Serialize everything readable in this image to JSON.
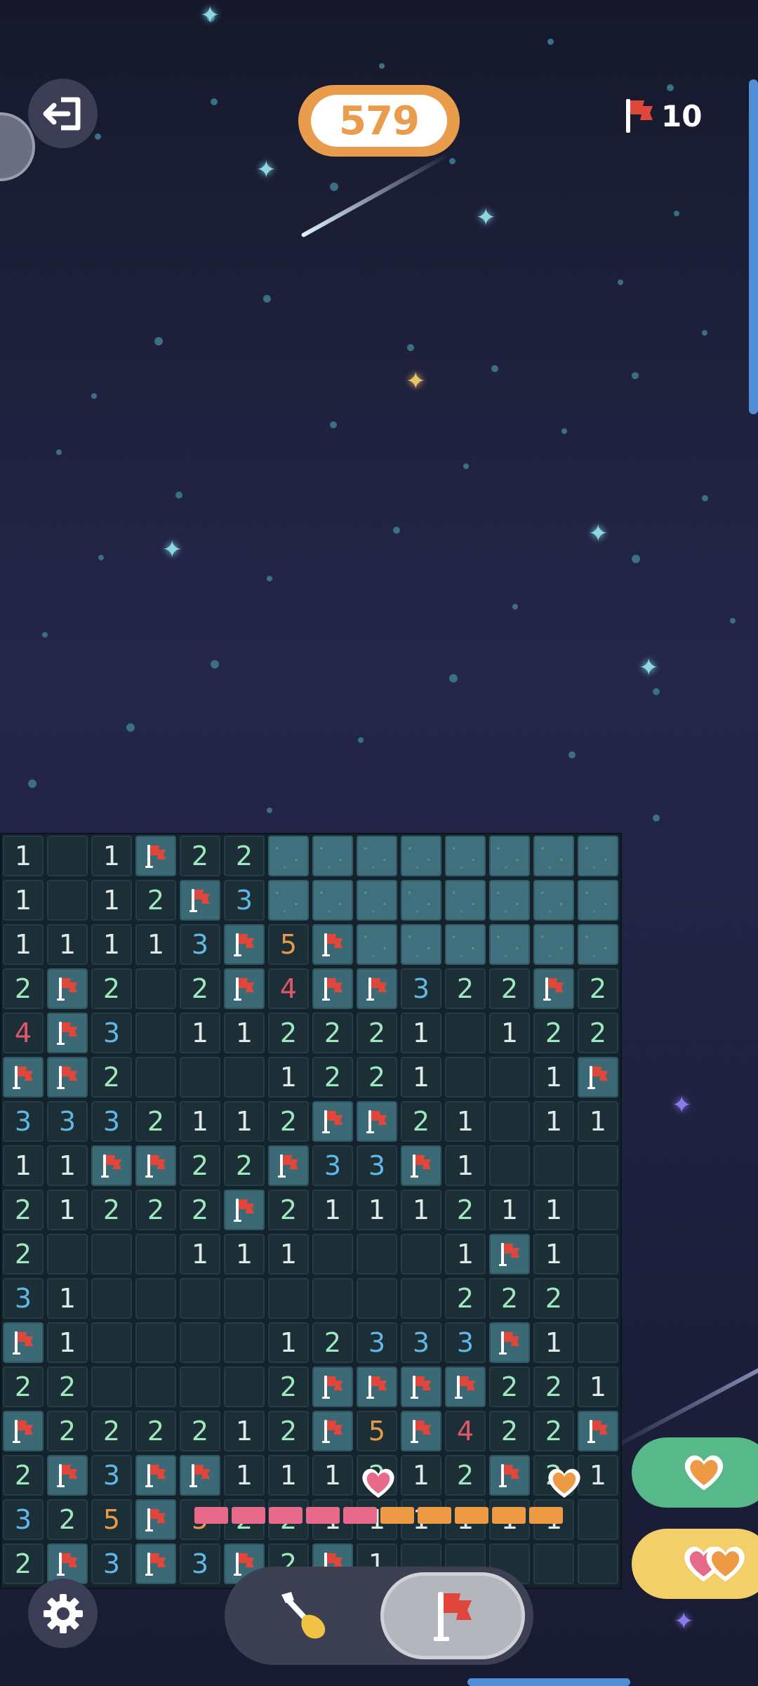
{
  "header": {
    "score": "579",
    "flags_remaining": "10"
  },
  "icons": {
    "exit": "exit-icon",
    "flag": "flag-icon",
    "settings": "gear-icon",
    "dig": "shovel-icon",
    "heart": "heart-icon",
    "double_heart": "double-heart-icon"
  },
  "colors": {
    "score_accent": "#e89c4c",
    "n1": "#dfe9e6",
    "n2": "#9fe8bd",
    "n3": "#5fb8e8",
    "n4": "#e2566a",
    "n5": "#e69a4a",
    "flag_red": "#e0473a",
    "life_green": "#57b98a",
    "life_yellow": "#f3cf6a",
    "progress_pink": "#e86a8a",
    "progress_orange": "#ee9a45"
  },
  "board": {
    "columns": 14,
    "rows": 17,
    "legend": "H = unrevealed, F = flag, . = empty revealed, 1-5 = adjacent count",
    "grid": [
      [
        "1",
        ".",
        "1",
        "F",
        "2",
        "2",
        "H",
        "H",
        "H",
        "H",
        "H",
        "H",
        "H",
        "H"
      ],
      [
        "1",
        ".",
        "1",
        "2",
        "F",
        "3",
        "H",
        "H",
        "H",
        "H",
        "H",
        "H",
        "H",
        "H"
      ],
      [
        "1",
        "1",
        "1",
        "1",
        "3",
        "F",
        "5",
        "F",
        "H",
        "H",
        "H",
        "H",
        "H",
        "H"
      ],
      [
        "2",
        "F",
        "2",
        ".",
        "2",
        "F",
        "4",
        "F",
        "F",
        "3",
        "2",
        "2",
        "F",
        "2"
      ],
      [
        "4",
        "F",
        "3",
        ".",
        "1",
        "1",
        "2",
        "2",
        "2",
        "1",
        ".",
        "1",
        "2",
        "2"
      ],
      [
        "F",
        "F",
        "2",
        ".",
        ".",
        ".",
        "1",
        "2",
        "2",
        "1",
        ".",
        ".",
        "1",
        "F"
      ],
      [
        "3",
        "3",
        "3",
        "2",
        "1",
        "1",
        "2",
        "F",
        "F",
        "2",
        "1",
        ".",
        "1",
        "1"
      ],
      [
        "1",
        "1",
        "F",
        "F",
        "2",
        "2",
        "F",
        "3",
        "3",
        "F",
        "1",
        ".",
        ".",
        "."
      ],
      [
        "2",
        "1",
        "2",
        "2",
        "2",
        "F",
        "2",
        "1",
        "1",
        "1",
        "2",
        "1",
        "1",
        "."
      ],
      [
        "2",
        ".",
        ".",
        ".",
        "1",
        "1",
        "1",
        ".",
        ".",
        ".",
        "1",
        "F",
        "1",
        "."
      ],
      [
        "3",
        "1",
        ".",
        ".",
        ".",
        ".",
        ".",
        ".",
        ".",
        ".",
        "2",
        "2",
        "2",
        "."
      ],
      [
        "F",
        "1",
        ".",
        ".",
        ".",
        ".",
        "1",
        "2",
        "3",
        "3",
        "3",
        "F",
        "1",
        "."
      ],
      [
        "2",
        "2",
        ".",
        ".",
        ".",
        ".",
        "2",
        "F",
        "F",
        "F",
        "F",
        "2",
        "2",
        "1"
      ],
      [
        "F",
        "2",
        "2",
        "2",
        "2",
        "1",
        "2",
        "F",
        "5",
        "F",
        "4",
        "2",
        "2",
        "F"
      ],
      [
        "2",
        "F",
        "3",
        "F",
        "F",
        "1",
        "1",
        "1",
        "2",
        "1",
        "2",
        "F",
        "2",
        "1"
      ],
      [
        "3",
        "2",
        "5",
        "F",
        "5",
        "2",
        "2",
        "1",
        "1",
        "1",
        "1",
        "1",
        "1",
        "."
      ],
      [
        "2",
        "F",
        "3",
        "F",
        "3",
        "F",
        "2",
        "F",
        "1",
        ".",
        ".",
        ".",
        ".",
        "."
      ]
    ]
  },
  "life_meter": {
    "segments": [
      "pink",
      "pink",
      "pink",
      "pink",
      "pink",
      "orange",
      "orange",
      "orange",
      "orange",
      "orange"
    ],
    "hearts": 2
  },
  "mode_toggle": {
    "selected": "flag",
    "options": [
      "dig",
      "flag"
    ]
  }
}
